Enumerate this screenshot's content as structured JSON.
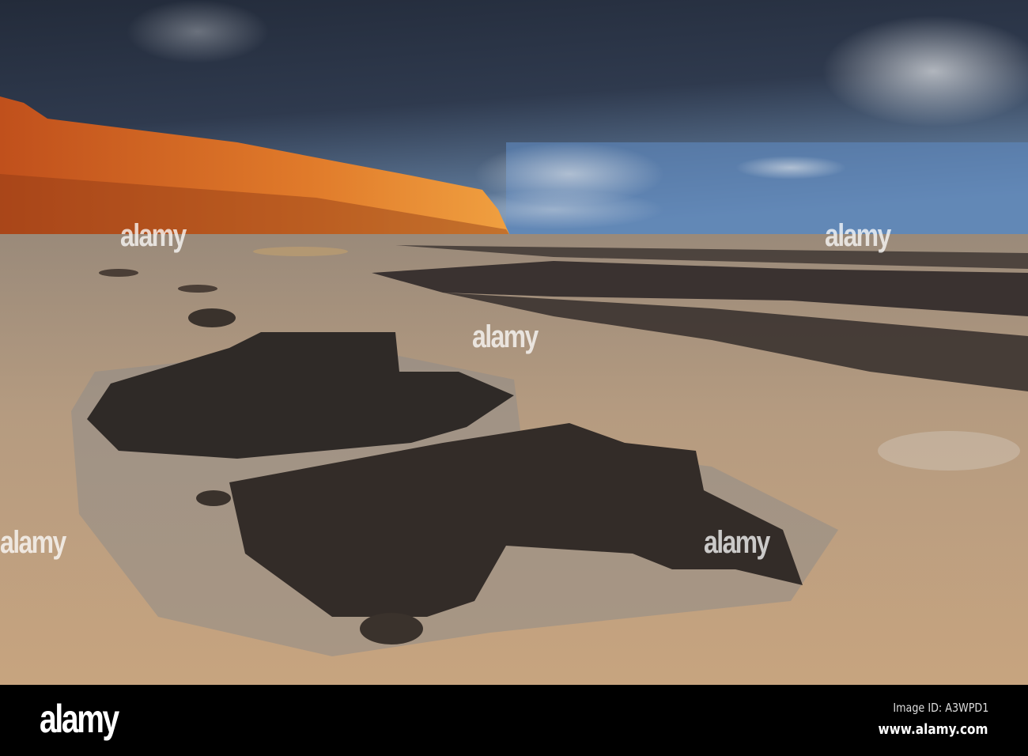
{
  "photo": {
    "subject": "Orange cliffs above a sandy beach with dark rocks and tide pools under stormy sky",
    "watermark_text": "alamy"
  },
  "footer": {
    "logo": "alamy",
    "image_id": "Image ID: A3WPD1",
    "website": "www.alamy.com"
  }
}
